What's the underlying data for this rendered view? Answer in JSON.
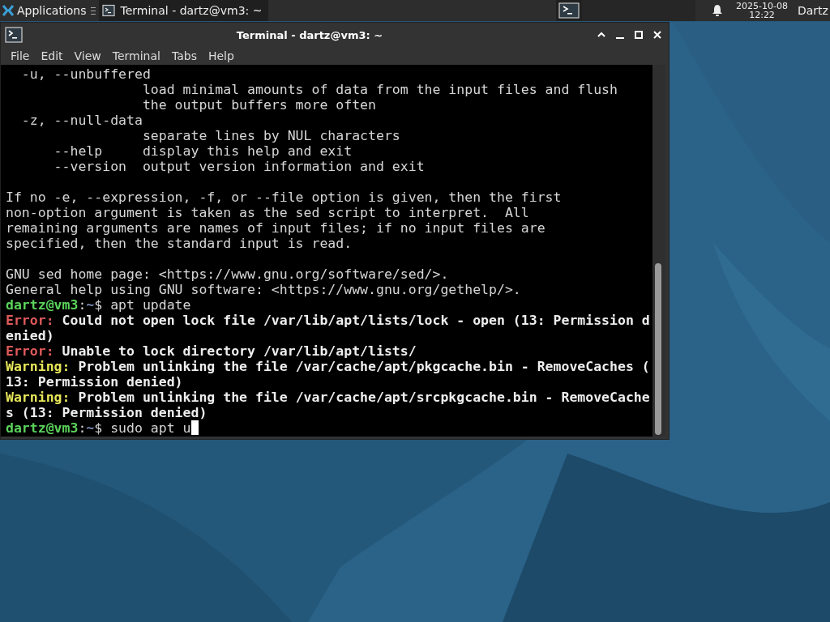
{
  "panel": {
    "apps_label": "Applications",
    "task": {
      "label": "Terminal - dartz@vm3: ~",
      "selected": true
    },
    "date": "2025-10-08",
    "time": "12:22",
    "user": "Dartz"
  },
  "window": {
    "title": "Terminal - dartz@vm3: ~",
    "menu": [
      "File",
      "Edit",
      "View",
      "Terminal",
      "Tabs",
      "Help"
    ]
  },
  "terminal": {
    "lines": [
      {
        "segments": [
          {
            "kind": "text",
            "text": "  -u, --unbuffered"
          }
        ]
      },
      {
        "segments": [
          {
            "kind": "text",
            "text": "                 load minimal amounts of data from the input files and flush"
          }
        ]
      },
      {
        "segments": [
          {
            "kind": "text",
            "text": "                 the output buffers more often"
          }
        ]
      },
      {
        "segments": [
          {
            "kind": "text",
            "text": "  -z, --null-data"
          }
        ]
      },
      {
        "segments": [
          {
            "kind": "text",
            "text": "                 separate lines by NUL characters"
          }
        ]
      },
      {
        "segments": [
          {
            "kind": "text",
            "text": "      --help     display this help and exit"
          }
        ]
      },
      {
        "segments": [
          {
            "kind": "text",
            "text": "      --version  output version information and exit"
          }
        ]
      },
      {
        "space_before": true,
        "segments": [
          {
            "kind": "text",
            "text": "If no -e, --expression, -f, or --file option is given, then the first"
          }
        ]
      },
      {
        "segments": [
          {
            "kind": "text",
            "text": "non-option argument is taken as the sed script to interpret.  All"
          }
        ]
      },
      {
        "segments": [
          {
            "kind": "text",
            "text": "remaining arguments are names of input files; if no input files are"
          }
        ]
      },
      {
        "segments": [
          {
            "kind": "text",
            "text": "specified, then the standard input is read."
          }
        ]
      },
      {
        "space_before": true,
        "segments": [
          {
            "kind": "text",
            "text": "GNU sed home page: <https://www.gnu.org/software/sed/>."
          }
        ]
      },
      {
        "segments": [
          {
            "kind": "text",
            "text": "General help using GNU software: <https://www.gnu.org/gethelp/>."
          }
        ]
      },
      {
        "segments": [
          {
            "kind": "user",
            "text": "dartz@vm3"
          },
          {
            "kind": "text",
            "text": ":"
          },
          {
            "kind": "path",
            "text": "~"
          },
          {
            "kind": "text",
            "text": "$ apt update"
          }
        ]
      },
      {
        "segments": [
          {
            "kind": "error",
            "text": "Error:"
          },
          {
            "kind": "bold",
            "text": " Could not open lock file /var/lib/apt/lists/lock - open (13: Permission d"
          }
        ]
      },
      {
        "segments": [
          {
            "kind": "bold",
            "text": "enied)"
          }
        ]
      },
      {
        "segments": [
          {
            "kind": "error",
            "text": "Error:"
          },
          {
            "kind": "bold",
            "text": " Unable to lock directory /var/lib/apt/lists/"
          }
        ]
      },
      {
        "segments": [
          {
            "kind": "warning",
            "text": "Warning:"
          },
          {
            "kind": "bold",
            "text": " Problem unlinking the file /var/cache/apt/pkgcache.bin - RemoveCaches ("
          }
        ]
      },
      {
        "segments": [
          {
            "kind": "bold",
            "text": "13: Permission denied)"
          }
        ]
      },
      {
        "segments": [
          {
            "kind": "warning",
            "text": "Warning:"
          },
          {
            "kind": "bold",
            "text": " Problem unlinking the file /var/cache/apt/srcpkgcache.bin - RemoveCache"
          }
        ]
      },
      {
        "segments": [
          {
            "kind": "bold",
            "text": "s (13: Permission denied)"
          }
        ]
      },
      {
        "cursor": true,
        "segments": [
          {
            "kind": "user",
            "text": "dartz@vm3"
          },
          {
            "kind": "text",
            "text": ":"
          },
          {
            "kind": "path",
            "text": "~"
          },
          {
            "kind": "text",
            "text": "$ sudo apt u"
          }
        ]
      }
    ]
  }
}
